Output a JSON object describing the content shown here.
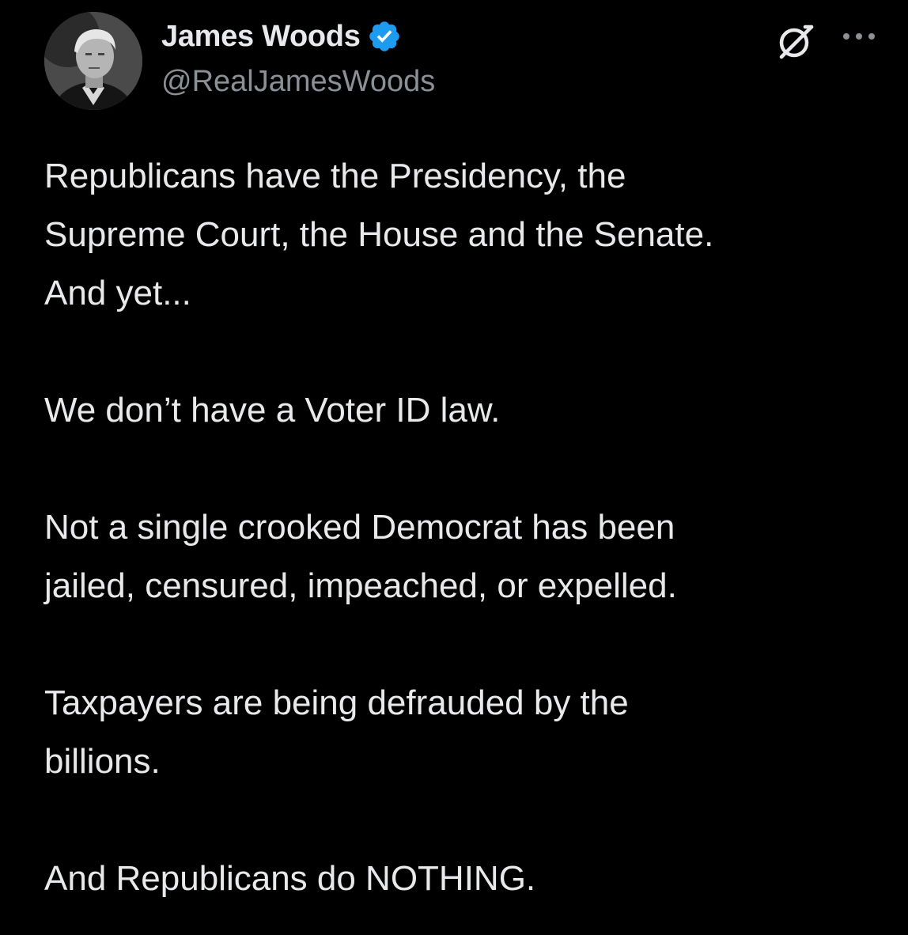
{
  "author": {
    "display_name": "James Woods",
    "handle": "@RealJamesWoods",
    "verified": true,
    "verified_color": "#1d9bf0"
  },
  "icons": {
    "avatar": "avatar-photo",
    "verified": "verified-badge-icon",
    "grok": "grok-icon",
    "more": "more-options-icon"
  },
  "colors": {
    "background": "#000000",
    "text": "#e7e9ea",
    "secondary_text": "#8b9096"
  },
  "tweet": {
    "paragraphs": [
      {
        "lines": [
          "Republicans have the Presidency, the",
          "Supreme Court, the House and the Senate.",
          "And yet..."
        ]
      },
      {
        "lines": [
          "We don’t have a Voter ID law."
        ]
      },
      {
        "lines": [
          "Not a single crooked Democrat has been",
          "jailed, censured, impeached, or expelled."
        ]
      },
      {
        "lines": [
          "Taxpayers are being defrauded by the",
          "billions."
        ]
      },
      {
        "lines": [
          "And Republicans do NOTHING."
        ]
      }
    ]
  }
}
